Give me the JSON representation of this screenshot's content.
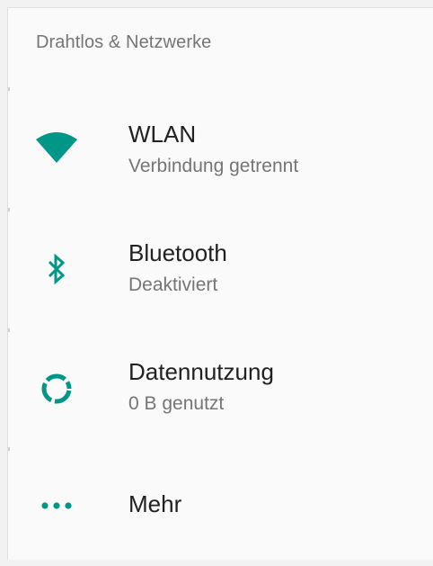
{
  "section": {
    "header": "Drahtlos & Netzwerke"
  },
  "items": [
    {
      "title": "WLAN",
      "summary": "Verbindung getrennt",
      "icon": "wifi-icon"
    },
    {
      "title": "Bluetooth",
      "summary": "Deaktiviert",
      "icon": "bluetooth-icon"
    },
    {
      "title": "Datennutzung",
      "summary": "0 B genutzt",
      "icon": "data-usage-icon"
    },
    {
      "title": "Mehr",
      "icon": "more-icon"
    }
  ],
  "colors": {
    "accent": "#009688",
    "title_text": "#212121",
    "secondary_text": "#757575",
    "background": "#fafafa"
  }
}
